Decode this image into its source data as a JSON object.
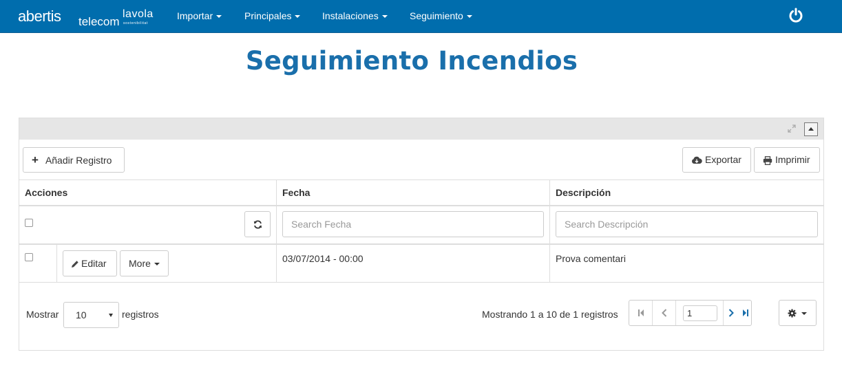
{
  "brand": {
    "name_part1": "abertis",
    "name_part2": "telecom",
    "partner": "lavola",
    "partner_sub": "sostenibilitat"
  },
  "nav": {
    "items": [
      {
        "label": "Importar"
      },
      {
        "label": "Principales"
      },
      {
        "label": "Instalaciones"
      },
      {
        "label": "Seguimiento"
      }
    ],
    "power_icon": "power-icon"
  },
  "page": {
    "title": "Seguimiento Incendios"
  },
  "toolbar": {
    "add_label": "Añadir Registro",
    "export_label": "Exportar",
    "print_label": "Imprimir"
  },
  "table": {
    "columns": [
      "Acciones",
      "Fecha",
      "Descripción"
    ],
    "search": {
      "fecha_placeholder": "Search Fecha",
      "descripcion_placeholder": "Search Descripción"
    },
    "rows": [
      {
        "fecha": "03/07/2014 - 00:00",
        "descripcion": "Prova comentari",
        "edit_label": "Editar",
        "more_label": "More"
      }
    ]
  },
  "footer": {
    "show_label": "Mostrar",
    "page_size": "10",
    "records_label": "registros",
    "summary": "Mostrando 1 a 10 de 1 registros",
    "current_page": "1"
  },
  "colors": {
    "navbar": "#006dad",
    "title": "#1a6fab",
    "pager_active": "#1a6fab"
  }
}
